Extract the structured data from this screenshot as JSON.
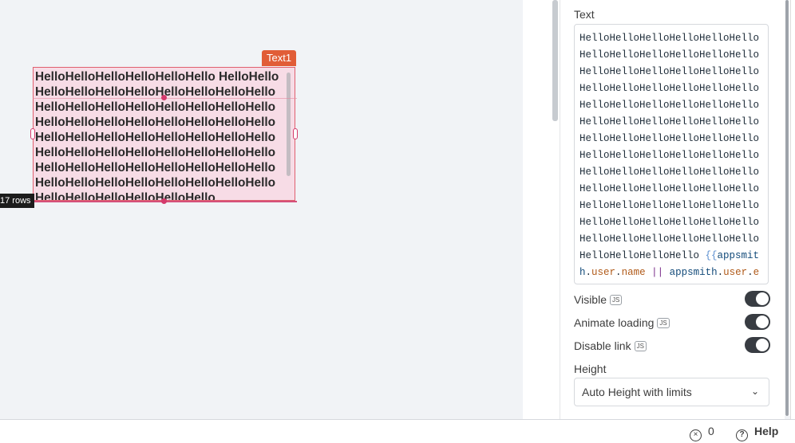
{
  "canvas": {
    "widget": {
      "name": "Text1",
      "text": "HelloHelloHelloHelloHelloHello HelloHelloHelloHelloHelloHelloHelloHelloHelloHelloHelloHelloHelloHelloHelloHelloHelloHelloHelloHelloHelloHelloHelloHelloHelloHelloHelloHelloHelloHelloHelloHelloHelloHelloHelloHelloHelloHelloHelloHelloHelloHelloHelloHelloHelloHelloHelloHelloHelloHelloHelloHelloHelloHelloHelloHelloHelloHelloHelloHelloHelloHelloHelloHello",
      "rows_badge": "17 rows"
    }
  },
  "property_pane": {
    "text_label": "Text",
    "text_value_plain": "HelloHelloHelloHelloHelloHello HelloHelloHelloHelloHelloHelloHelloHelloHelloHelloHelloHelloHelloHelloHelloHelloHelloHelloHelloHelloHelloHelloHelloHelloHelloHelloHelloHelloHelloHelloHelloHelloHelloHelloHelloHelloHelloHelloHelloHelloHelloHelloHelloHelloHelloHelloHelloHelloHelloHelloHelloHelloHelloHelloHelloHelloHelloHelloHelloHelloHelloHelloHelloHelloHelloHelloHelloHelloHelloHelloHelloHelloHelloHelloHelloHello ",
    "binding": {
      "open": "{{",
      "ident1": "appsmith",
      "dot1": ".",
      "prop1": "user",
      "dot2": ".",
      "prop2": "name",
      "op": " || ",
      "ident2": "appsmith",
      "dot3": ".",
      "prop3": "user",
      "dot4": ".",
      "prop4": "email",
      "close": "}}"
    },
    "toggles": [
      {
        "label": "Visible",
        "badge": "JS",
        "on": true
      },
      {
        "label": "Animate loading",
        "badge": "JS",
        "on": true
      },
      {
        "label": "Disable link",
        "badge": "JS",
        "on": true
      }
    ],
    "height_label": "Height",
    "height_value": "Auto Height with limits"
  },
  "bottom_bar": {
    "error_count": "0",
    "help_label": "Help"
  },
  "colors": {
    "widget_tag": "#e15d37",
    "widget_bg": "#f7dce6",
    "toggle_on": "#383c42"
  }
}
